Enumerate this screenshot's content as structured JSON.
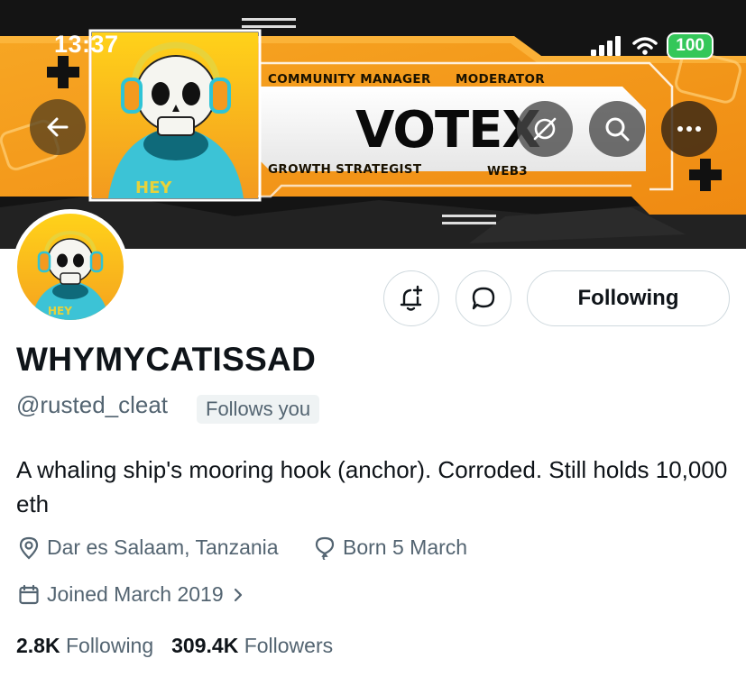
{
  "status_bar": {
    "time": "13:37",
    "battery": "100"
  },
  "banner": {
    "tag_top_left": "COMMUNITY MANAGER",
    "tag_top_right": "MODERATOR",
    "brand": "VOTEX",
    "tag_bottom_left": "GROWTH STRATEGIST",
    "tag_bottom_right": "WEB3",
    "colors": {
      "orange": "#f39a1f",
      "dark": "#111111",
      "cyan": "#2ec4d6"
    }
  },
  "profile": {
    "display_name": "WHYMYCATISSAD",
    "handle": "@rusted_cleat",
    "follows_you": "Follows you",
    "bio": "A whaling ship's mooring hook (anchor). Corroded. Still holds 10,000 eth",
    "location": "Dar es Salaam, Tanzania",
    "birthday": "Born 5 March",
    "joined": "Joined March 2019"
  },
  "actions": {
    "following_label": "Following"
  },
  "stats": {
    "following_count": "2.8K",
    "following_label": "Following",
    "followers_count": "309.4K",
    "followers_label": "Followers"
  }
}
